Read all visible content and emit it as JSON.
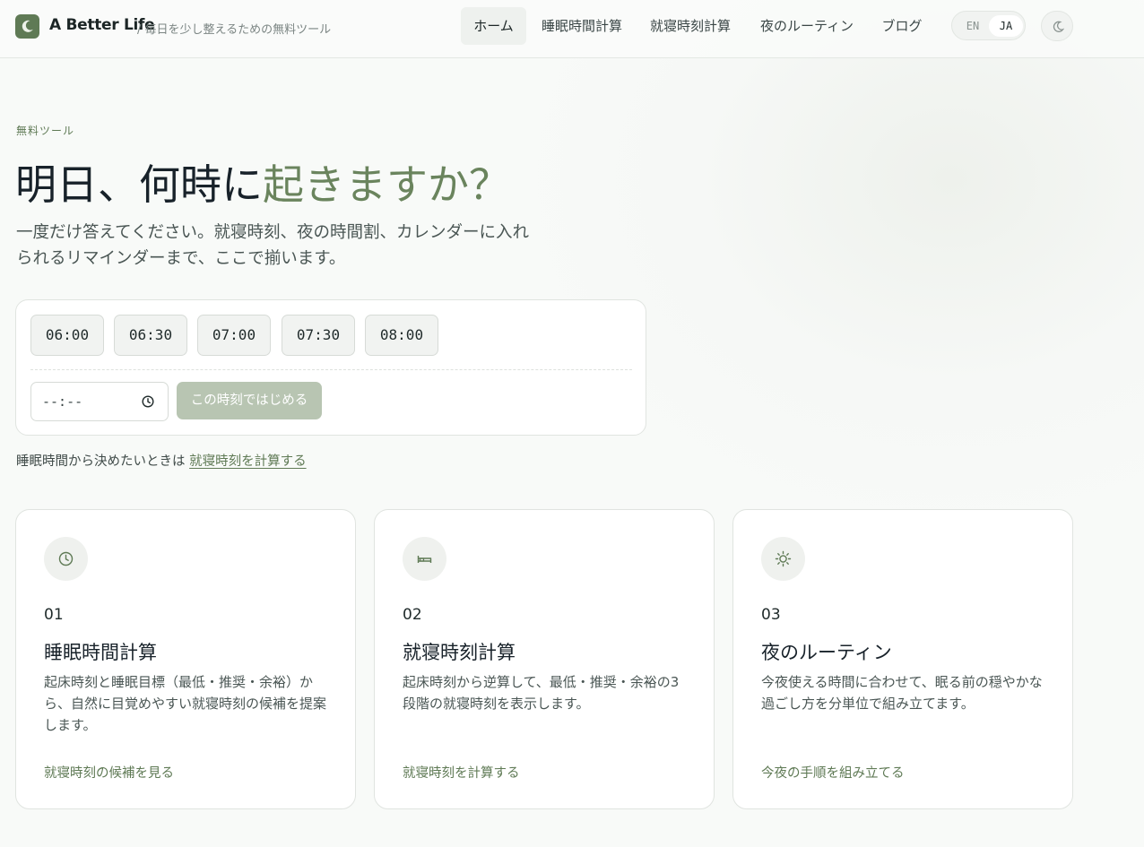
{
  "brand": {
    "name": "A Better Life",
    "tagline": "/ 毎日を少し整えるための無料ツール",
    "logo_icon": "moon-icon"
  },
  "nav": {
    "items": [
      {
        "label": "ホーム",
        "active": true
      },
      {
        "label": "睡眠時間計算",
        "active": false
      },
      {
        "label": "就寝時刻計算",
        "active": false
      },
      {
        "label": "夜のルーティン",
        "active": false
      },
      {
        "label": "ブログ",
        "active": false
      }
    ],
    "lang": {
      "en": "EN",
      "ja": "JA",
      "selected": "JA"
    },
    "theme_icon": "moon-icon"
  },
  "hero": {
    "eyebrow": "無料ツール",
    "title_main": "明日、何時に",
    "title_accent": "起きますか？",
    "subtitle": "一度だけ答えてください。就寝時刻、夜の時間割、カレンダーに入れられるリマインダーまで、ここで揃います。"
  },
  "time_picker": {
    "presets": [
      "06:00",
      "06:30",
      "07:00",
      "07:30",
      "08:00"
    ],
    "custom_value": "--:--",
    "custom_icon": "clock-icon",
    "start_label": "この時刻ではじめる"
  },
  "hint": {
    "text": "睡眠時間から決めたいときは ",
    "link": "就寝時刻を計算する"
  },
  "cards": [
    {
      "icon": "clock-icon",
      "num": "01",
      "title": "睡眠時間計算",
      "desc": "起床時刻と睡眠目標（最低・推奨・余裕）から、自然に目覚めやすい就寝時刻の候補を提案します。",
      "link": "就寝時刻の候補を見る"
    },
    {
      "icon": "bed-icon",
      "num": "02",
      "title": "就寝時刻計算",
      "desc": "起床時刻から逆算して、最低・推奨・余裕の3段階の就寝時刻を表示します。",
      "link": "就寝時刻を計算する"
    },
    {
      "icon": "sun-icon",
      "num": "03",
      "title": "夜のルーティン",
      "desc": "今夜使える時間に合わせて、眠る前の穏やかな過ごし方を分単位で組み立てます。",
      "link": "今夜の手順を組み立てる"
    }
  ],
  "colors": {
    "accent": "#5f7a55",
    "accent_light": "#6a845d",
    "button_disabled": "#b8c5b2"
  }
}
